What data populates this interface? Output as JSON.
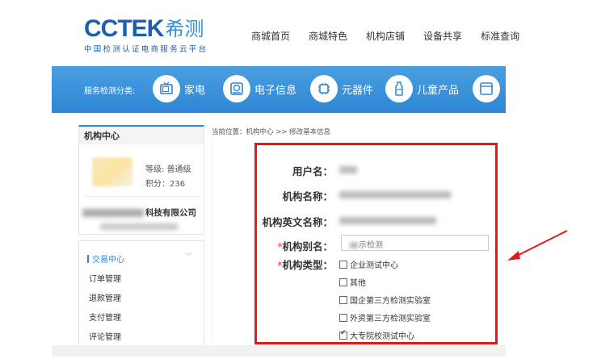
{
  "header": {
    "logo_text": "CCTEK",
    "logo_cn": "希测",
    "logo_sub": "中国检测认证电商服务云平台",
    "nav": [
      "商城首页",
      "商城特色",
      "机构店铺",
      "设备共享",
      "标准查询"
    ]
  },
  "category_band": {
    "label": "服务检测分类:",
    "items": [
      {
        "label": "家电",
        "icon": "tv-icon"
      },
      {
        "label": "电子信息",
        "icon": "hard-drive-icon"
      },
      {
        "label": "元器件",
        "icon": "chip-icon"
      },
      {
        "label": "儿童产品",
        "icon": "baby-bottle-icon"
      },
      {
        "label": "",
        "icon": "window-icon"
      }
    ]
  },
  "breadcrumb": "当前位置：机构中心 >> 修改基本信息",
  "sidebar": {
    "title": "机构中心",
    "level": "等级: 普通级",
    "points": "积分：236",
    "company_suffix": "科技有限公司",
    "section": "交易中心",
    "items": [
      "订单管理",
      "退款管理",
      "支付管理",
      "评论管理"
    ]
  },
  "form": {
    "username_label": "用户名：",
    "org_name_label": "机构名称：",
    "org_en_name_label": "机构英文名称：",
    "alias_label": "机构别名：",
    "alias_value": "示检测",
    "type_label": "机构类型：",
    "required_mark": "*",
    "types": [
      {
        "label": "企业测试中心",
        "checked": false
      },
      {
        "label": "其他",
        "checked": false
      },
      {
        "label": "国企第三方检测实验室",
        "checked": false
      },
      {
        "label": "外资第三方检测实验室",
        "checked": false
      },
      {
        "label": "大专院校测试中心",
        "checked": true
      }
    ]
  },
  "colors": {
    "brand_blue": "#2e86d4",
    "annotation_red": "#e01919"
  }
}
